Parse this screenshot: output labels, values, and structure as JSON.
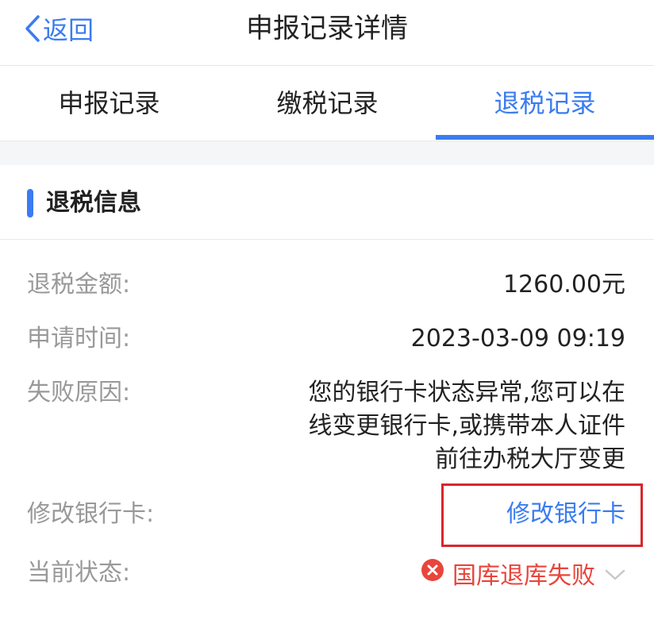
{
  "nav": {
    "back_label": "返回",
    "title": "申报记录详情"
  },
  "tabs": [
    {
      "label": "申报记录",
      "active": false
    },
    {
      "label": "缴税记录",
      "active": false
    },
    {
      "label": "退税记录",
      "active": true
    }
  ],
  "section": {
    "title": "退税信息"
  },
  "fields": {
    "amount": {
      "label": "退税金额:",
      "value": "1260.00元"
    },
    "apply_time": {
      "label": "申请时间:",
      "value": "2023-03-09 09:19"
    },
    "fail_reason": {
      "label": "失败原因:",
      "value": "您的银行卡状态异常,您可以在\n线变更银行卡,或携带本人证件\n前往办税大厅变更"
    },
    "modify_card": {
      "label": "修改银行卡:",
      "link": "修改银行卡"
    },
    "status": {
      "label": "当前状态:",
      "value": "国库退库失败",
      "icon": "error-circle-icon"
    }
  },
  "colors": {
    "accent": "#3b7cf0",
    "error": "#e8453c",
    "highlight_border": "#d8262b"
  }
}
